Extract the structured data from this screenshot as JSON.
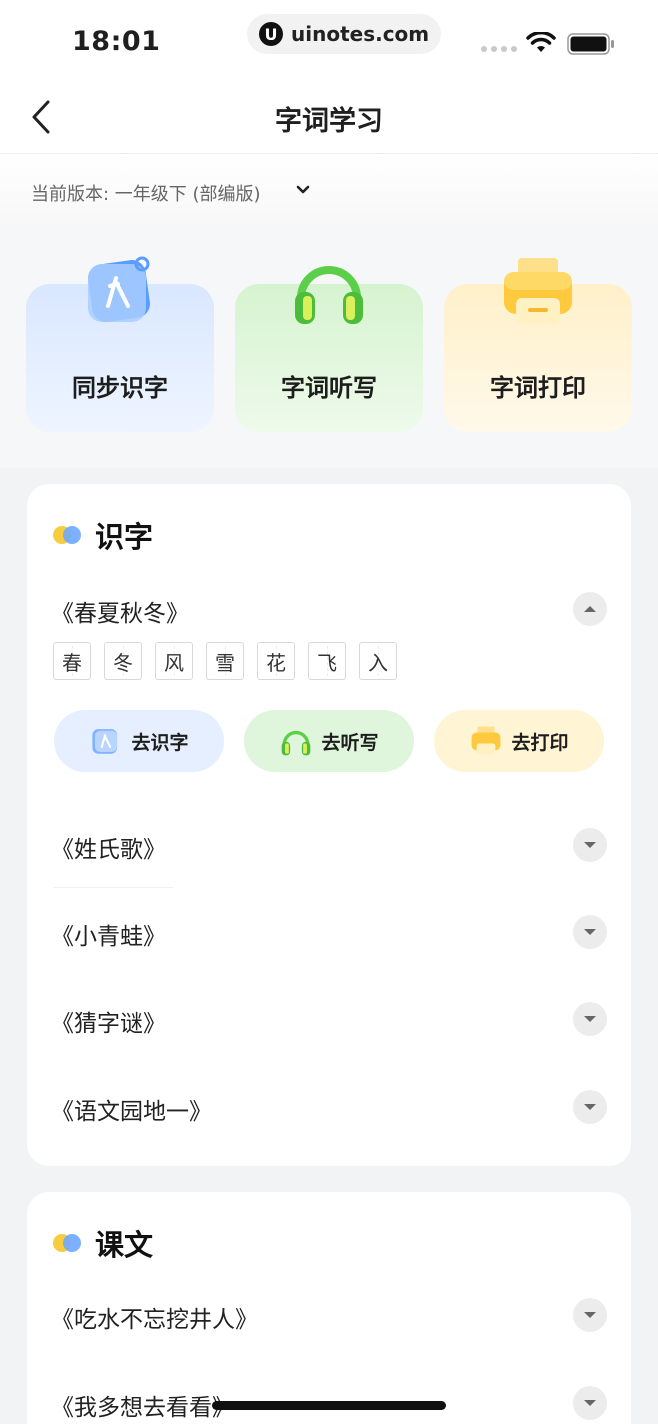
{
  "status_bar": {
    "time": "18:01",
    "url": "uinotes.com",
    "url_logo": "U"
  },
  "nav": {
    "title": "字词学习"
  },
  "version": {
    "label": "当前版本: 一年级下 (部编版)"
  },
  "features": [
    {
      "label": "同步识字",
      "icon": "literacy-card-icon",
      "color": "#dbe8ff"
    },
    {
      "label": "字词听写",
      "icon": "headphones-icon",
      "color": "#d8f3d1"
    },
    {
      "label": "字词打印",
      "icon": "printer-icon",
      "color": "#fff1cc"
    }
  ],
  "sections": [
    {
      "title": "识字",
      "expanded_lesson": {
        "title": "《春夏秋冬》",
        "chars": [
          "春",
          "冬",
          "风",
          "雪",
          "花",
          "飞",
          "入"
        ],
        "actions": [
          {
            "label": "去识字",
            "icon": "literacy-card-icon"
          },
          {
            "label": "去听写",
            "icon": "headphones-icon"
          },
          {
            "label": "去打印",
            "icon": "printer-icon"
          }
        ]
      },
      "lessons": [
        "《姓氏歌》",
        "《小青蛙》",
        "《猜字谜》",
        "《语文园地一》"
      ]
    },
    {
      "title": "课文",
      "lessons": [
        "《吃水不忘挖井人》",
        "《我多想去看看》"
      ]
    }
  ],
  "colors": {
    "accent_blue": "#6ea8ff",
    "accent_yellow": "#f7cd3f",
    "accent_green": "#5ccf4a"
  }
}
